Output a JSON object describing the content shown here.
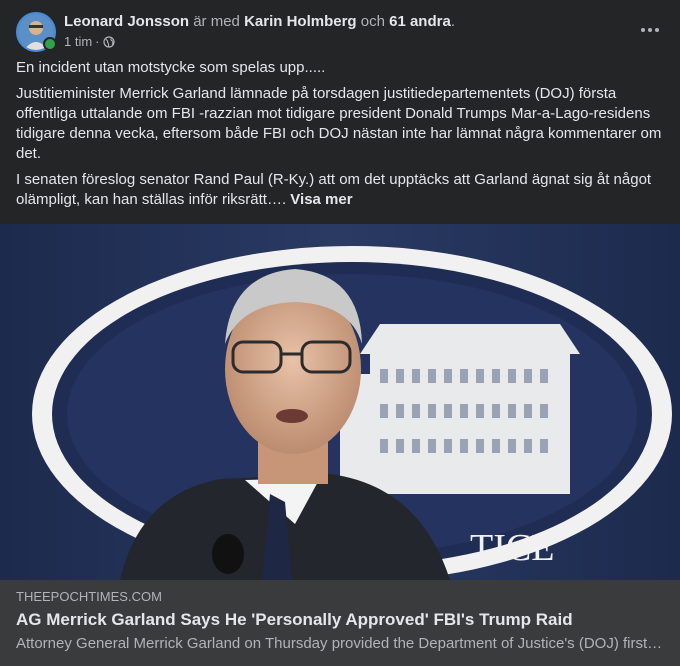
{
  "post": {
    "author": "Leonard Jonsson",
    "with_text": "är med",
    "tagged_user": "Karin Holmberg",
    "and_text": "och",
    "others": "61 andra",
    "period": ".",
    "time": "1 tim",
    "separator": "·",
    "privacy_icon": "globe-icon",
    "paragraphs": [
      "En incident utan motstycke som spelas upp.....",
      "Justitieminister Merrick Garland lämnade på torsdagen justitiedepartementets (DOJ) första offentliga uttalande om FBI -razzian mot tidigare president Donald Trumps Mar-a-Lago-residens tidigare denna vecka, eftersom både FBI och DOJ nästan inte har lämnat några kommentarer om det.",
      "I senaten föreslog senator Rand Paul (R-Ky.) att om det upptäcks att Garland ägnat sig åt något olämpligt, kan han ställas inför riksrätt…."
    ],
    "see_more": "Visa mer"
  },
  "image": {
    "seal_text": "TICE"
  },
  "link_preview": {
    "domain": "THEEPOCHTIMES.COM",
    "title": "AG Merrick Garland Says He 'Personally Approved' FBI's Trump Raid",
    "description": "Attorney General Merrick Garland on Thursday provided the Department of Justice's (DOJ) first public statement on the FBI raid"
  },
  "colors": {
    "background": "#242526",
    "preview_background": "#3a3b3c",
    "online": "#31a24c"
  }
}
